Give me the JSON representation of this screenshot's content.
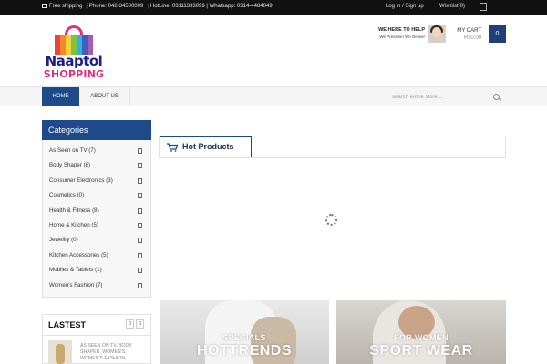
{
  "topbar": {
    "shipping": "Free shipping",
    "phone": "Phone: 042-34500099",
    "hotline": "HotLine: 03111333099 | Whatsapp: 0314-4484049",
    "login": "Log in / Sign up",
    "wishlist": "Wishlist(0)"
  },
  "logo": {
    "line1": "Naaptol",
    "line2": "SHOPPING"
  },
  "help": {
    "title": "WE HERE TO HELP",
    "subtitle": "We Pressise! We Deliver"
  },
  "cart": {
    "label": "MY CART",
    "amount": "Rs0.00",
    "count": "0"
  },
  "nav": {
    "home": "HOME",
    "about": "ABOUT US",
    "search_placeholder": "search entire store ..."
  },
  "categories": {
    "title": "Categories",
    "items": [
      {
        "label": "As Seen on TV (7)"
      },
      {
        "label": "Body Shaper (8)"
      },
      {
        "label": "Consumer Electronics (3)"
      },
      {
        "label": "Cosmetics (0)"
      },
      {
        "label": "Health & Fitness (8)"
      },
      {
        "label": "Home & Kitchen (5)"
      },
      {
        "label": "Jewellry (0)"
      },
      {
        "label": "Kitchen Accessories (5)"
      },
      {
        "label": "Mobiles & Tablets (1)"
      },
      {
        "label": "Women's Fashion (7)"
      }
    ]
  },
  "hot_products": {
    "title": "Hot Products"
  },
  "banners": {
    "left": {
      "line1": "SPECIALS",
      "line2": "HOTTRENDS"
    },
    "right": {
      "line1": "FOR WOMEN",
      "line2": "SPORT WEAR"
    }
  },
  "lastest": {
    "title": "LASTEST",
    "prev": "0",
    "next": "0",
    "item_text": "AS SEEN ON TV, BODY SHAPER, WOMEN'S, WOMEN'S FASHION,"
  },
  "colors": {
    "accent": "#1e4a8c",
    "topbar": "#111111",
    "logo_pink": "#e02d7d",
    "logo_navy": "#1d1d8c"
  }
}
